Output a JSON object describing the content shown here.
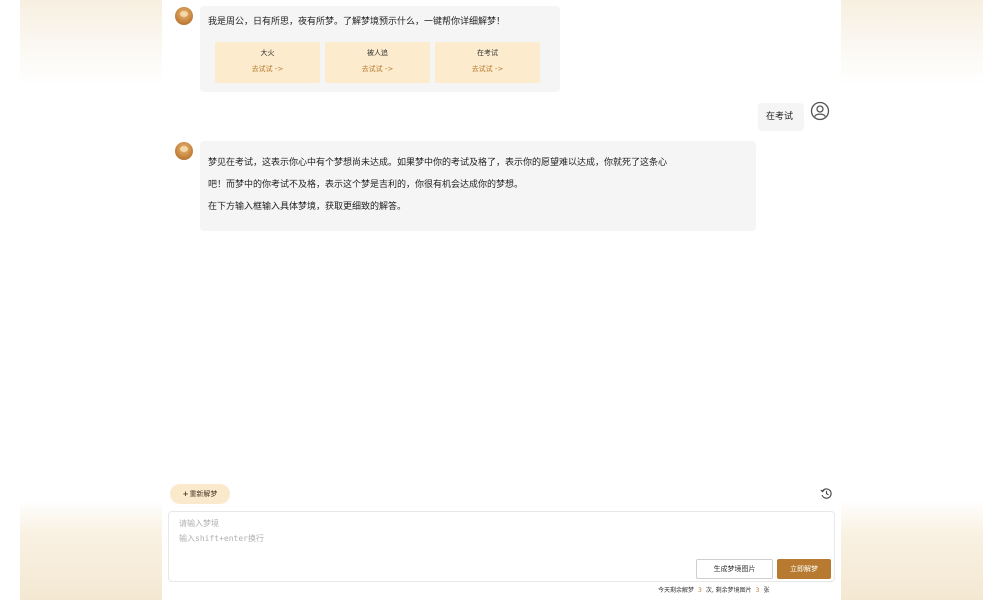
{
  "chat": {
    "welcome": {
      "text": "我是周公，日有所思，夜有所梦。了解梦境预示什么，一键帮你详细解梦！",
      "chips": [
        {
          "title": "大火",
          "try_label": "去试试 ->"
        },
        {
          "title": "被人追",
          "try_label": "去试试 ->"
        },
        {
          "title": "在考试",
          "try_label": "去试试 ->"
        }
      ]
    },
    "user_message": "在考试",
    "reply": {
      "line1": "梦见在考试，这表示你心中有个梦想尚未达成。如果梦中你的考试及格了，表示你的愿望难以达成，你就死了这条心",
      "line2": "吧！而梦中的你考试不及格，表示这个梦是吉利的，你很有机会达成你的梦想。",
      "line3": "在下方输入框输入具体梦境，获取更细致的解答。"
    }
  },
  "toolbar": {
    "new_dream_label": "重新解梦",
    "new_dream_icon": "plus-icon",
    "history_icon": "history-icon"
  },
  "input": {
    "placeholder": "请输入梦境\n输入shift+enter换行",
    "value": ""
  },
  "actions": {
    "generate_image_label": "生成梦境图片",
    "interpret_label": "立即解梦"
  },
  "quota": {
    "prefix": "今天剩余解梦",
    "dream_count": "3",
    "middle": "次, 剩余梦境图片",
    "image_count": "3",
    "suffix": "张"
  },
  "colors": {
    "accent": "#b77a30",
    "chip_background": "#fcebcd",
    "bubble_background": "#f5f5f5",
    "side_band": "#f7efe0"
  }
}
